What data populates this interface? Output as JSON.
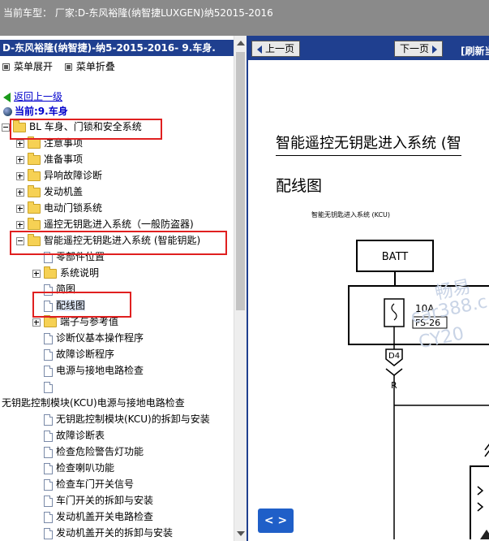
{
  "topbar": {
    "title": "当前车型：  厂家:D-东风裕隆(纳智捷LUXGEN)纳52015-2016"
  },
  "left": {
    "header": "D-东风裕隆(纳智捷)-纳5-2015-2016- 9.车身.",
    "expand_label": "菜单展开",
    "collapse_label": "菜单折叠",
    "back_label": "返回上一级",
    "current_label": "当前:9.车身",
    "tree": [
      {
        "text": "BL 车身、门锁和安全系统",
        "indent": 0,
        "toggle": "minus",
        "icon": "folder",
        "boxed": true
      },
      {
        "text": "注意事项",
        "indent": 1,
        "toggle": "plus",
        "icon": "folder"
      },
      {
        "text": "准备事项",
        "indent": 1,
        "toggle": "plus",
        "icon": "folder"
      },
      {
        "text": "异响故障诊断",
        "indent": 1,
        "toggle": "plus",
        "icon": "folder"
      },
      {
        "text": "发动机盖",
        "indent": 1,
        "toggle": "plus",
        "icon": "folder"
      },
      {
        "text": "电动门锁系统",
        "indent": 1,
        "toggle": "plus",
        "icon": "folder"
      },
      {
        "text": "遥控无钥匙进入系统（一般防盗器)",
        "indent": 1,
        "toggle": "plus",
        "icon": "folder"
      },
      {
        "text": "智能遥控无钥匙进入系统 (智能钥匙)",
        "indent": 1,
        "toggle": "minus",
        "icon": "folder",
        "boxed": true
      },
      {
        "text": "零部件位置",
        "indent": 2,
        "toggle": "",
        "icon": "doc"
      },
      {
        "text": "系统说明",
        "indent": 2,
        "toggle": "plus",
        "icon": "folder"
      },
      {
        "text": "简图",
        "indent": 2,
        "toggle": "",
        "icon": "doc"
      },
      {
        "text": "配线图",
        "indent": 2,
        "toggle": "",
        "icon": "doc",
        "boxed": true,
        "selected": true
      },
      {
        "text": "端子与参考值",
        "indent": 2,
        "toggle": "plus",
        "icon": "folder"
      },
      {
        "text": "诊断仪基本操作程序",
        "indent": 2,
        "toggle": "",
        "icon": "doc"
      },
      {
        "text": "故障诊断程序",
        "indent": 2,
        "toggle": "",
        "icon": "doc"
      },
      {
        "text": "电源与接地电路检查",
        "indent": 2,
        "toggle": "",
        "icon": "doc"
      },
      {
        "text": "",
        "indent": 2,
        "toggle": "",
        "icon": "doc"
      },
      {
        "text": "无钥匙控制模块(KCU)电源与接地电路检查",
        "indent": -1,
        "toggle": "",
        "icon": "none"
      },
      {
        "text": "无钥匙控制模块(KCU)的拆卸与安装",
        "indent": 2,
        "toggle": "",
        "icon": "doc"
      },
      {
        "text": "故障诊断表",
        "indent": 2,
        "toggle": "",
        "icon": "doc"
      },
      {
        "text": "检查危险警告灯功能",
        "indent": 2,
        "toggle": "",
        "icon": "doc"
      },
      {
        "text": "检查喇叭功能",
        "indent": 2,
        "toggle": "",
        "icon": "doc"
      },
      {
        "text": "检查车门开关信号",
        "indent": 2,
        "toggle": "",
        "icon": "doc"
      },
      {
        "text": "车门开关的拆卸与安装",
        "indent": 2,
        "toggle": "",
        "icon": "doc"
      },
      {
        "text": "发动机盖开关电路检查",
        "indent": 2,
        "toggle": "",
        "icon": "doc"
      },
      {
        "text": "发动机盖开关的拆卸与安装",
        "indent": 2,
        "toggle": "",
        "icon": "doc"
      }
    ]
  },
  "right": {
    "prev_label": "上一页",
    "next_label": "下一页",
    "refresh_label": "[刷新当",
    "doc_title": "智能遥控无钥匙进入系统 (智",
    "doc_subtitle": "配线图",
    "diagram_caption": "智能无钥匙进入系统 (KCU)",
    "batt_label": "BATT",
    "fuse_rating": "10A",
    "fuse_id": "FS-26",
    "connector_id": "D4",
    "wire_color": "R",
    "watermark_1": "畅易",
    "watermark_2": "car388.c",
    "watermark_3": "CY20",
    "nav_circle_label": "< >"
  }
}
